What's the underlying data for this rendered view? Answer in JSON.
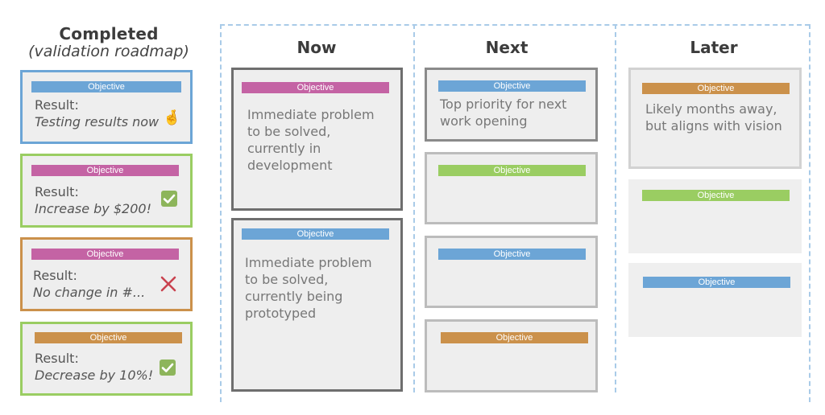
{
  "colors": {
    "blue": "#6ca5d6",
    "magenta": "#c463a4",
    "green": "#9acd62",
    "orange": "#cb914b",
    "frame_dash": "#a9cbe8",
    "success": "#8db55b",
    "failure": "#c9424f"
  },
  "completed": {
    "title": "Completed",
    "subtitle": "(validation roadmap)",
    "cards": [
      {
        "objective": "Objective",
        "objective_color": "blue",
        "border_color": "blue",
        "result_label": "Result:",
        "result_value": "Testing results now",
        "status_icon": "crossed-fingers-icon",
        "status_glyph": "🤞"
      },
      {
        "objective": "Objective",
        "objective_color": "magenta",
        "border_color": "green",
        "result_label": "Result:",
        "result_value": "Increase by $200!",
        "status_icon": "checkmark-icon"
      },
      {
        "objective": "Objective",
        "objective_color": "magenta",
        "border_color": "orange",
        "result_label": "Result:",
        "result_value": "No change in #...",
        "status_icon": "x-mark-icon"
      },
      {
        "objective": "Objective",
        "objective_color": "orange",
        "border_color": "green",
        "result_label": "Result:",
        "result_value": "Decrease by 10%!",
        "status_icon": "checkmark-icon"
      }
    ]
  },
  "columns": [
    {
      "title": "Now",
      "cards": [
        {
          "objective": "Objective",
          "objective_color": "magenta",
          "description": "Immediate problem to be solved, currently in development"
        },
        {
          "objective": "Objective",
          "objective_color": "blue",
          "description": "Immediate problem to be solved, currently being prototyped"
        }
      ]
    },
    {
      "title": "Next",
      "cards": [
        {
          "objective": "Objective",
          "objective_color": "blue",
          "description": "Top priority for next work opening"
        },
        {
          "objective": "Objective",
          "objective_color": "green",
          "description": ""
        },
        {
          "objective": "Objective",
          "objective_color": "blue",
          "description": ""
        },
        {
          "objective": "Objective",
          "objective_color": "orange",
          "description": ""
        }
      ]
    },
    {
      "title": "Later",
      "cards": [
        {
          "objective": "Objective",
          "objective_color": "orange",
          "description": "Likely months away, but aligns with vision"
        },
        {
          "objective": "Objective",
          "objective_color": "green",
          "description": ""
        },
        {
          "objective": "Objective",
          "objective_color": "blue",
          "description": ""
        }
      ]
    }
  ]
}
